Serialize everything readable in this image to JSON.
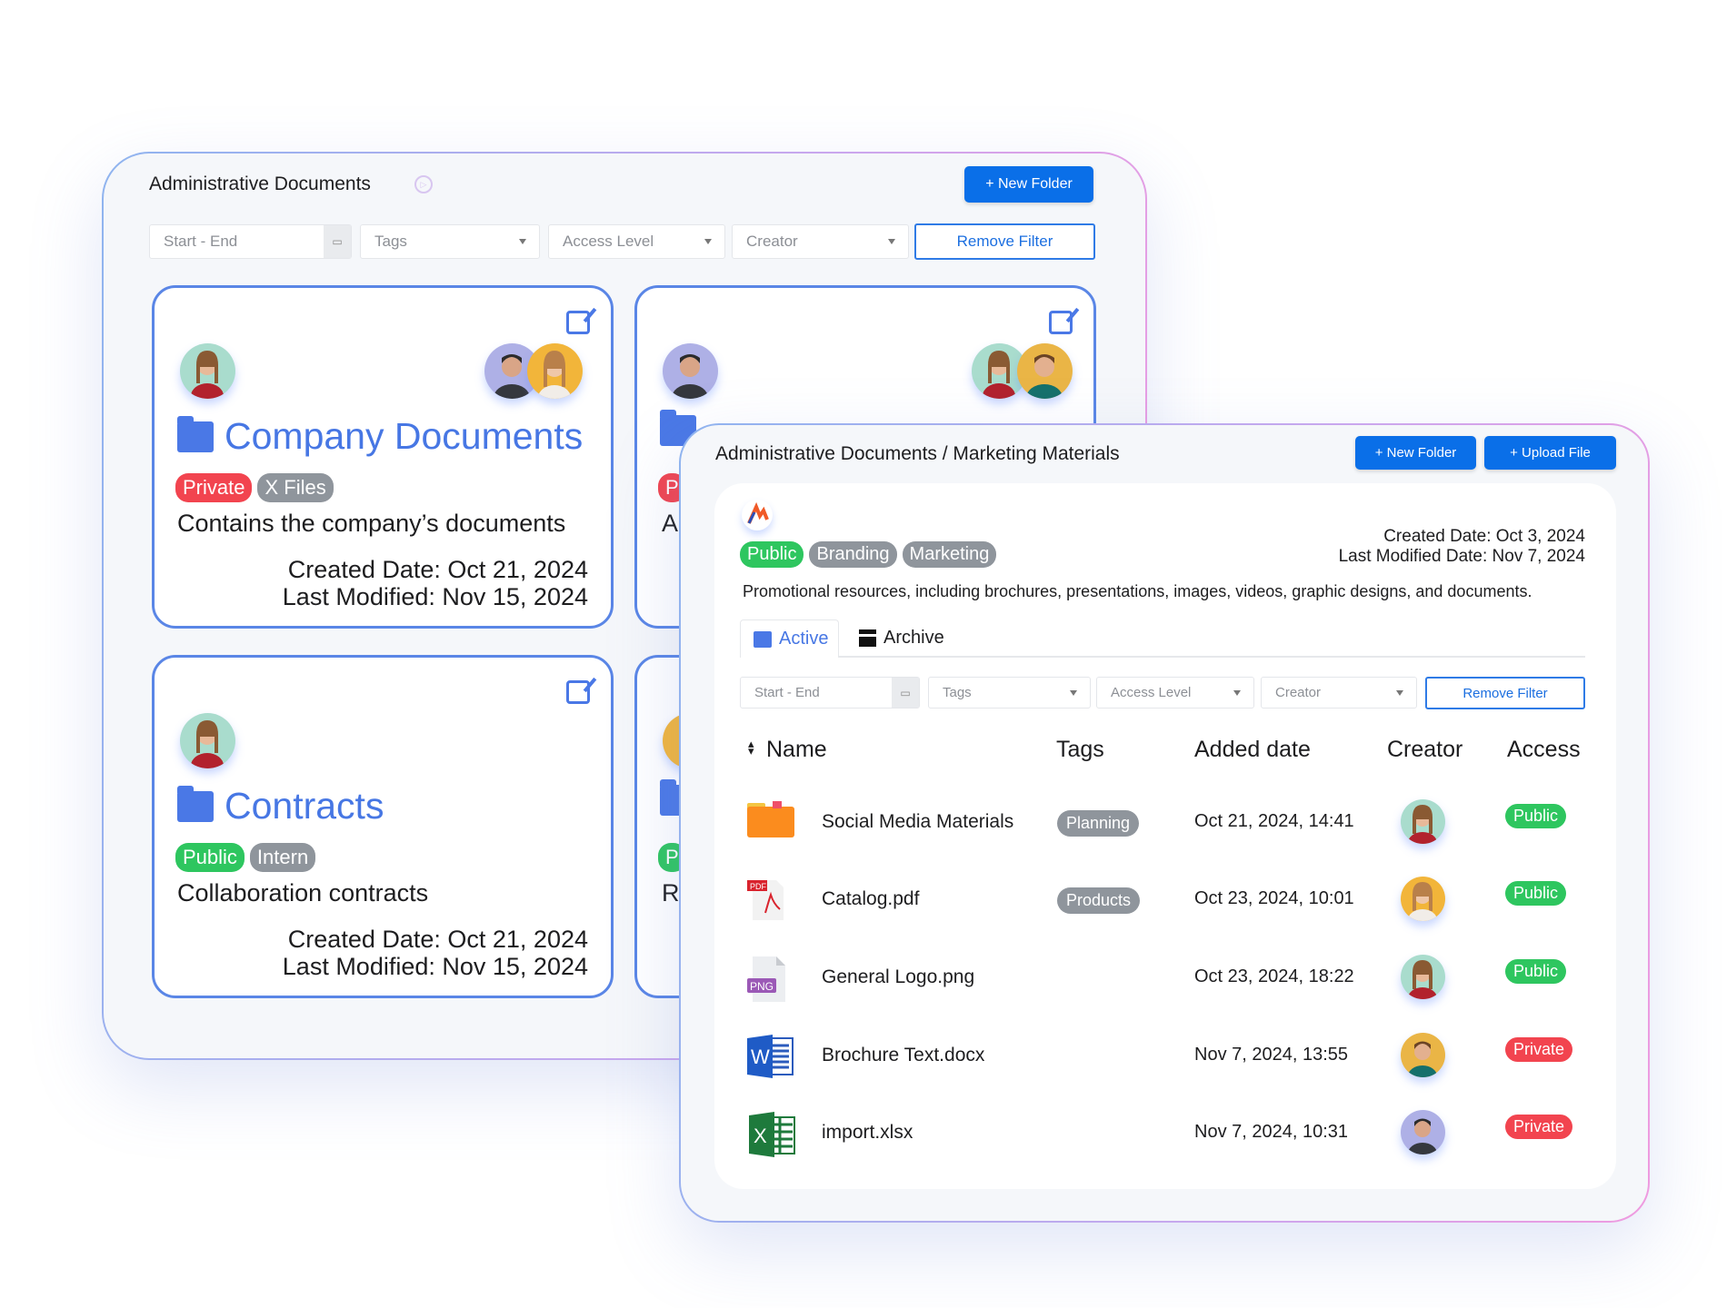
{
  "colors": {
    "accent": "#0a6fe8",
    "folder_blue": "#4a78e6",
    "public": "#2ec65f",
    "private": "#f2444f",
    "tag_gray": "#8f959c"
  },
  "back_panel": {
    "title": "Administrative Documents",
    "title_icon": "play-circle-icon",
    "new_folder": "+ New Folder",
    "filters": {
      "date": "Start - End",
      "tags": "Tags",
      "access": "Access Level",
      "creator": "Creator",
      "remove": "Remove Filter"
    },
    "cards": [
      {
        "title": "Company Documents",
        "tags": [
          {
            "label": "Private",
            "kind": "red"
          },
          {
            "label": "X Files",
            "kind": "gray"
          }
        ],
        "description": "Contains the company’s documents",
        "created": "Created Date: Oct 21, 2024",
        "modified": "Last Modified: Nov 15, 2024"
      },
      {
        "tag_fragment": "P",
        "description_fragment": "A"
      },
      {
        "title": "Contracts",
        "tags": [
          {
            "label": "Public",
            "kind": "green"
          },
          {
            "label": "Intern",
            "kind": "gray"
          }
        ],
        "description": "Collaboration contracts",
        "created": "Created Date: Oct 21, 2024",
        "modified": "Last Modified: Nov 15, 2024"
      },
      {
        "tag_fragment": "P",
        "description_fragment": "R"
      }
    ]
  },
  "front_panel": {
    "breadcrumb": "Administrative Documents / Marketing Materials",
    "new_folder": "+ New Folder",
    "upload_file": "+ Upload File",
    "tags": [
      "Public",
      "Branding",
      "Marketing"
    ],
    "created": "Created Date: Oct 3, 2024",
    "modified": "Last Modified Date: Nov 7, 2024",
    "description": "Promotional resources, including brochures, presentations, images, videos, graphic designs, and documents.",
    "tabs": [
      "Active",
      "Archive"
    ],
    "filters": {
      "date": "Start - End",
      "tags": "Tags",
      "access": "Access Level",
      "creator": "Creator",
      "remove": "Remove Filter"
    },
    "columns": [
      "Name",
      "Tags",
      "Added date",
      "Creator",
      "Access"
    ],
    "rows": [
      {
        "name": "Social Media Materials",
        "icon": "folder-icon",
        "tag": "Planning",
        "date": "Oct 21, 2024, 14:41",
        "access": "Public"
      },
      {
        "name": "Catalog.pdf",
        "icon": "pdf-file-icon",
        "tag": "Products",
        "date": "Oct 23, 2024, 10:01",
        "access": "Public"
      },
      {
        "name": "General Logo.png",
        "icon": "png-file-icon",
        "tag": "",
        "date": "Oct 23, 2024, 18:22",
        "access": "Public"
      },
      {
        "name": "Brochure Text.docx",
        "icon": "word-file-icon",
        "tag": "",
        "date": "Nov 7, 2024, 13:55",
        "access": "Private"
      },
      {
        "name": "import.xlsx",
        "icon": "excel-file-icon",
        "tag": "",
        "date": "Nov 7, 2024, 10:31",
        "access": "Private"
      }
    ]
  }
}
